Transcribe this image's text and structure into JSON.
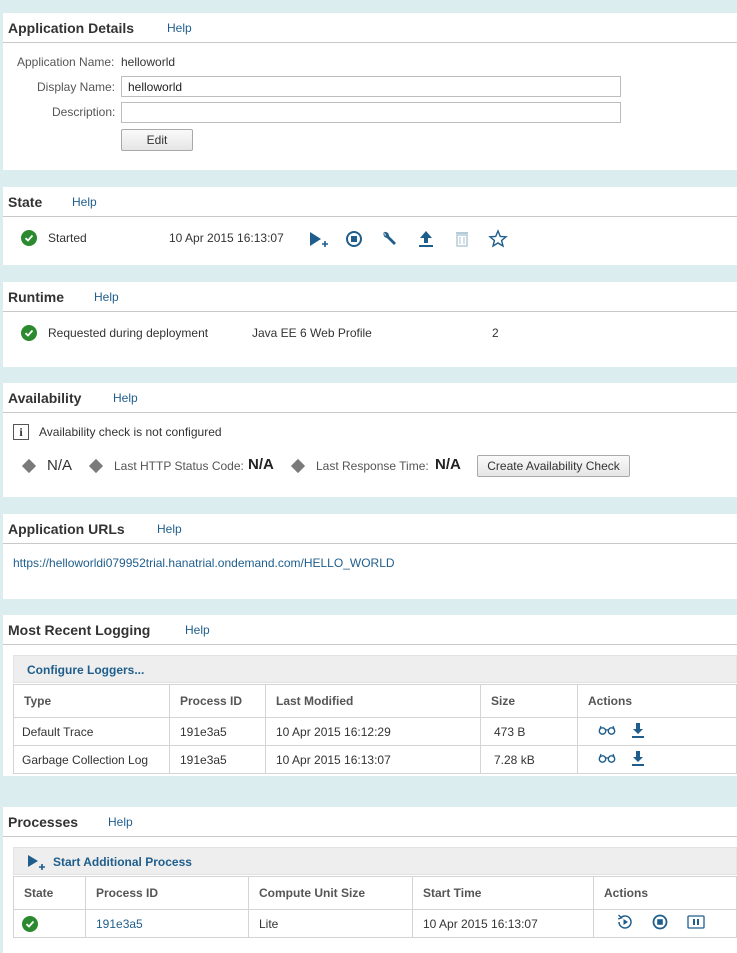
{
  "app_details": {
    "title": "Application Details",
    "help": "Help",
    "app_name_label": "Application Name:",
    "app_name_value": "helloworld",
    "display_name_label": "Display Name:",
    "display_name_value": "helloworld",
    "description_label": "Description:",
    "description_value": "",
    "edit_label": "Edit"
  },
  "state": {
    "title": "State",
    "help": "Help",
    "status": "Started",
    "timestamp": "10 Apr 2015 16:13:07",
    "actions": [
      "start-additional-icon",
      "stop-icon",
      "wrench-icon",
      "upload-icon",
      "trash-icon",
      "star-icon"
    ]
  },
  "runtime": {
    "title": "Runtime",
    "help": "Help",
    "status": "Requested during deployment",
    "profile": "Java EE 6 Web Profile",
    "count": "2"
  },
  "availability": {
    "title": "Availability",
    "help": "Help",
    "info": "Availability check is not configured",
    "status_value": "N/A",
    "http_label": "Last HTTP Status Code:",
    "http_value": "N/A",
    "response_label": "Last Response Time:",
    "response_value": "N/A",
    "create_button": "Create Availability Check"
  },
  "urls": {
    "title": "Application URLs",
    "help": "Help",
    "url": "https://helloworldi079952trial.hanatrial.ondemand.com/HELLO_WORLD"
  },
  "logging": {
    "title": "Most Recent Logging",
    "help": "Help",
    "configure": "Configure Loggers...",
    "columns": [
      "Type",
      "Process ID",
      "Last Modified",
      "Size",
      "Actions"
    ],
    "rows": [
      {
        "type": "Default Trace",
        "pid": "191e3a5",
        "modified": "10 Apr 2015 16:12:29",
        "size": "473 B"
      },
      {
        "type": "Garbage Collection Log",
        "pid": "191e3a5",
        "modified": "10 Apr 2015 16:13:07",
        "size": "7.28 kB"
      }
    ]
  },
  "processes": {
    "title": "Processes",
    "help": "Help",
    "start": "Start Additional Process",
    "columns": [
      "State",
      "Process ID",
      "Compute Unit Size",
      "Start Time",
      "Actions"
    ],
    "rows": [
      {
        "pid": "191e3a5",
        "size": "Lite",
        "start": "10 Apr 2015 16:13:07"
      }
    ]
  },
  "colors": {
    "accent": "#1f5e8c",
    "ok": "#2b8a2f",
    "background": "#dcedf0"
  }
}
